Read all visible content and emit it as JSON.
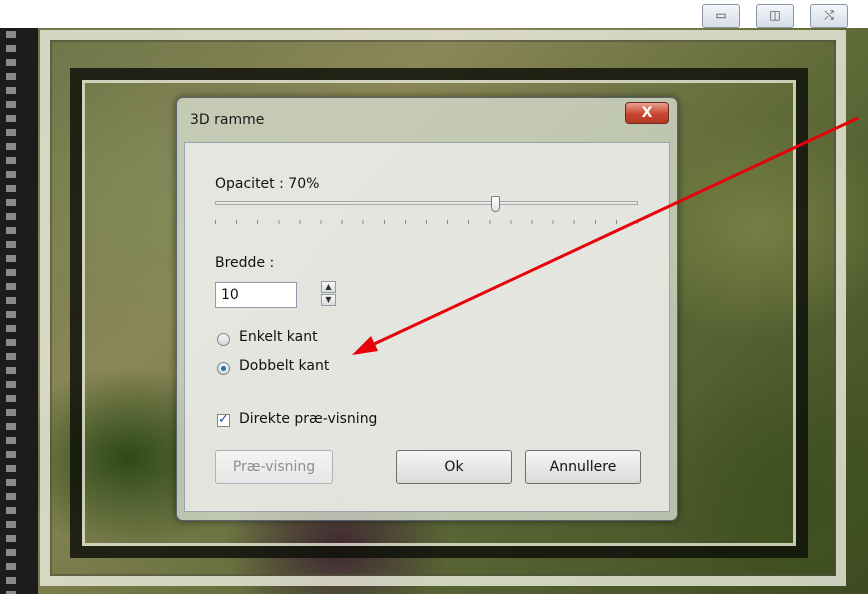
{
  "window_controls": {
    "minimize_glyph": "▭",
    "maximize_glyph": "◫",
    "close_glyph": "⤭"
  },
  "dialog": {
    "title": "3D ramme",
    "close_glyph": "X",
    "opacity_label": "Opacitet : 70%",
    "opacity_value_percent": 70,
    "width_label": "Bredde :",
    "width_value": "10",
    "spin_up_glyph": "▲",
    "spin_down_glyph": "▼",
    "radio_single": "Enkelt kant",
    "radio_double": "Dobbelt kant",
    "radio_selected": "Dobbelt kant",
    "preview_checkbox": "Direkte præ-visning",
    "preview_checked": true,
    "preview_button": "Præ-visning",
    "ok_button": "Ok",
    "cancel_button": "Annullere"
  },
  "annotation": {
    "arrow_color": "#e8000b"
  }
}
